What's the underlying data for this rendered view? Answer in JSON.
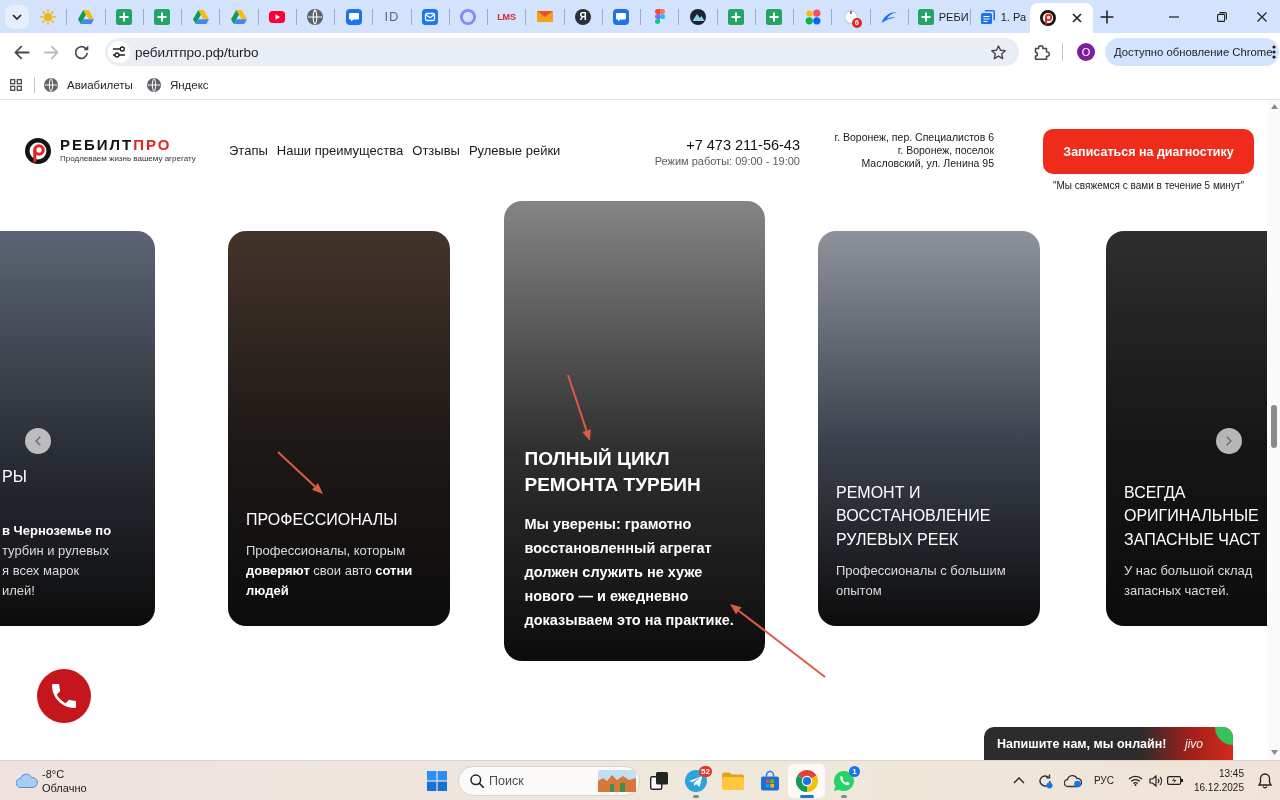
{
  "browser": {
    "tabs": [
      {
        "kind": "sun",
        "selected": false
      },
      {
        "kind": "triangle",
        "selected": false
      },
      {
        "kind": "sheet",
        "selected": false
      },
      {
        "kind": "sheet",
        "selected": false
      },
      {
        "kind": "triangle",
        "selected": false
      },
      {
        "kind": "triangle",
        "selected": false
      },
      {
        "kind": "video",
        "selected": false
      },
      {
        "kind": "globe",
        "selected": false
      },
      {
        "kind": "chat",
        "selected": false
      },
      {
        "kind": "letters",
        "glyph": "ID",
        "selected": false
      },
      {
        "kind": "mail",
        "selected": false
      },
      {
        "kind": "ring",
        "selected": false
      },
      {
        "kind": "wordmark",
        "glyph": "LMS",
        "selected": false
      },
      {
        "kind": "envelope",
        "selected": false
      },
      {
        "kind": "disc",
        "glyph": "Я",
        "selected": false
      },
      {
        "kind": "chat",
        "selected": false
      },
      {
        "kind": "shapes",
        "selected": false
      },
      {
        "kind": "mountain",
        "selected": false
      },
      {
        "kind": "sheet",
        "selected": false
      },
      {
        "kind": "sheet",
        "selected": false
      },
      {
        "kind": "dots",
        "selected": false
      },
      {
        "kind": "badge",
        "glyph": "6",
        "selected": false
      },
      {
        "kind": "swoosh",
        "selected": false
      },
      {
        "kind": "sheet",
        "title": "РЕБИ",
        "selected": false
      },
      {
        "kind": "pages",
        "title": "1. Ра",
        "selected": false
      },
      {
        "kind": "logo",
        "selected": true
      }
    ],
    "nav_buttons": [
      {
        "kind": "back",
        "disabled": false
      },
      {
        "kind": "forward",
        "disabled": true
      },
      {
        "kind": "reload",
        "disabled": false
      }
    ],
    "address": "ребилтпро.рф/turbo",
    "profile_initial": "О",
    "update_button": "Доступно обновление Chrome",
    "bookmarks": [
      {
        "label": "Авиабилеты"
      },
      {
        "label": "Яндекс"
      }
    ]
  },
  "site": {
    "logo": {
      "name": "РЕБИЛТ",
      "accent": "ПРО",
      "tagline": "Продлеваем жизнь вашему агрегату"
    },
    "nav": [
      "Этапы",
      "Наши преимущества",
      "Отзывы",
      "Рулевые рейки"
    ],
    "phone": "+7 473 211-56-43",
    "hours": "Режим работы: 09:00 - 19:00",
    "addresses": [
      "г. Воронеж, пер. Специалистов 6",
      "г. Воронеж, поселок Масловский, ул. Ленина 95"
    ],
    "cta": {
      "label": "Записаться на диагностику",
      "note": "\"Мы свяжемся с вами в течение 5 минут\""
    }
  },
  "slides": [
    {
      "title": "РЫ",
      "text": "**в Черноземье по**\nтурбин и рулевых\nя всех марок\nилей!",
      "selected": false
    },
    {
      "title": "ПРОФЕССИОНАЛЫ",
      "text": "Профессионалы, которым **доверяют** свои авто **сотни людей**",
      "selected": false
    },
    {
      "title": "ПОЛНЫЙ ЦИКЛ РЕМОНТА ТУРБИН",
      "text": "Мы уверены: грамотно восстановленный агрегат должен служить не хуже нового — и ежедневно доказываем это на практике.",
      "selected": true
    },
    {
      "title": "РЕМОНТ И ВОССТАНОВЛЕНИЕ РУЛЕВЫХ РЕЕК",
      "text": "Профессионалы с большим опытом",
      "selected": false
    },
    {
      "title": "ВСЕГДА ОРИГИНАЛЬНЫЕ ЗАПАСНЫЕ ЧАСТ",
      "text": "У нас большой склад запасных частей.",
      "selected": false
    }
  ],
  "chat_widget": {
    "text": "Напишите нам, мы онлайн!",
    "brand": "jivo"
  },
  "taskbar": {
    "weather": {
      "temperature": "-8°C",
      "condition": "Облачно"
    },
    "search": {
      "placeholder": "Поиск"
    },
    "apps": [
      {
        "kind": "taskview",
        "running": false,
        "selected": false
      },
      {
        "kind": "telegram",
        "badge": "52",
        "running": true,
        "selected": false
      },
      {
        "kind": "folder",
        "running": false,
        "selected": false
      },
      {
        "kind": "store",
        "running": false,
        "selected": false
      },
      {
        "kind": "chrome",
        "running": true,
        "selected": true
      },
      {
        "kind": "whatsapp",
        "badge": "1",
        "running": true,
        "selected": false
      }
    ],
    "language": "РУС",
    "time": "13:45",
    "date": "16.12.2025"
  }
}
